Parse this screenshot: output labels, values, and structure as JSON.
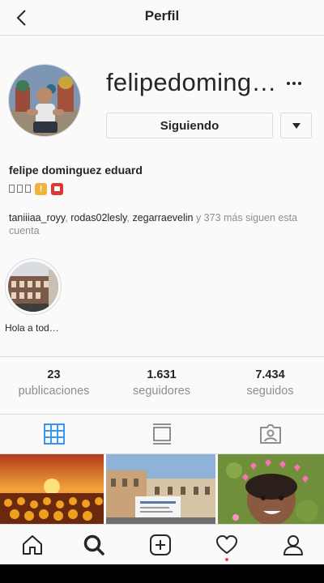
{
  "header": {
    "title": "Perfil"
  },
  "profile": {
    "username": "felipedoming…",
    "following_button": "Siguiendo",
    "full_name": "felipe dominguez eduard",
    "followed_by": {
      "users": [
        "taniiiaa_royy",
        "rodas02lesly",
        "zegarraevelin"
      ],
      "separator": ", ",
      "suffix": " y 373 más siguen esta cuenta"
    }
  },
  "highlights": [
    {
      "label": "Hola a tod…"
    }
  ],
  "stats": [
    {
      "value": "23",
      "label": "publicaciones"
    },
    {
      "value": "1.631",
      "label": "seguidores"
    },
    {
      "value": "7.434",
      "label": "seguidos"
    }
  ],
  "tabs": [
    {
      "icon": "grid-icon",
      "active": true
    },
    {
      "icon": "feed-icon",
      "active": false
    },
    {
      "icon": "tagged-icon",
      "active": false
    }
  ],
  "colors": {
    "active_tab": "#3897f0",
    "inactive_tab": "#8e8e8e",
    "notification_dot": "#ed4956"
  },
  "bottom_nav": [
    {
      "icon": "home-icon"
    },
    {
      "icon": "search-icon",
      "active": true
    },
    {
      "icon": "new-post-icon"
    },
    {
      "icon": "activity-heart-icon",
      "has_notification": true
    },
    {
      "icon": "profile-icon"
    }
  ]
}
